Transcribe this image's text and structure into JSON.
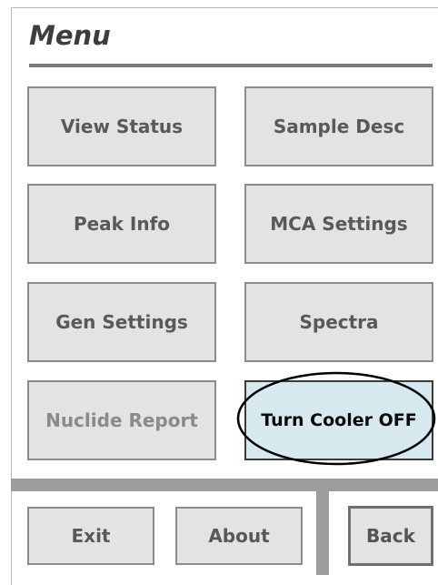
{
  "menu": {
    "title": "Menu",
    "buttons": {
      "view_status": "View Status",
      "sample_desc": "Sample Desc",
      "peak_info": "Peak Info",
      "mca_settings": "MCA Settings",
      "gen_settings": "Gen Settings",
      "spectra": "Spectra",
      "nuclide_report": "Nuclide Report",
      "turn_cooler_off": "Turn Cooler OFF"
    }
  },
  "footer": {
    "exit": "Exit",
    "about": "About",
    "back": "Back"
  },
  "colors": {
    "button_bg": "#e3e3e3",
    "highlight_bg": "#d5e9ef",
    "divider": "#9d9d9d"
  }
}
